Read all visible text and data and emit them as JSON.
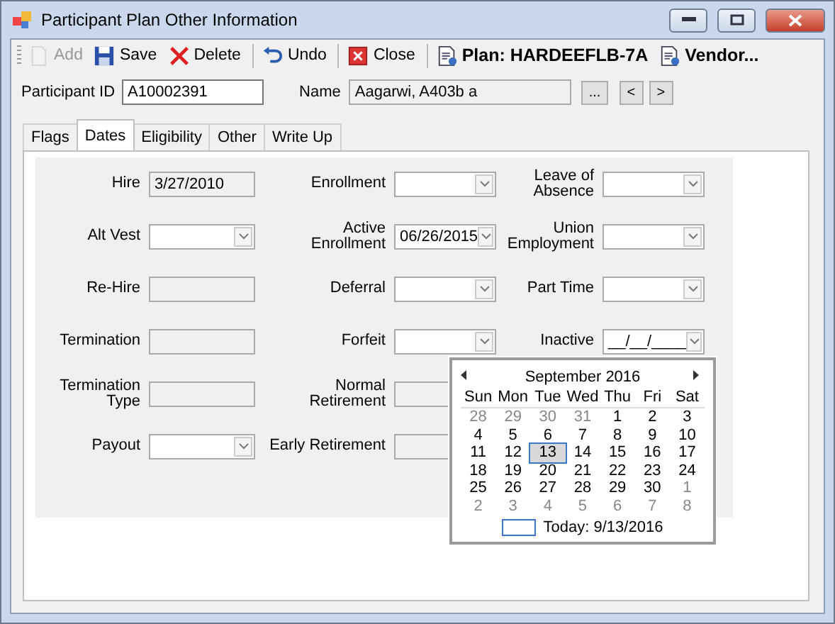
{
  "window": {
    "title": "Participant Plan Other Information"
  },
  "toolbar": [
    {
      "label": "Add",
      "disabled": true,
      "bold": false,
      "separator_before": false
    },
    {
      "label": "Save",
      "disabled": false,
      "bold": false,
      "separator_before": false
    },
    {
      "label": "Delete",
      "disabled": false,
      "bold": false,
      "separator_before": false
    },
    {
      "label": "Undo",
      "disabled": false,
      "bold": false,
      "separator_before": true
    },
    {
      "label": "Close",
      "disabled": false,
      "bold": false,
      "separator_before": true
    },
    {
      "label": "Plan: HARDEEFLB-7A",
      "disabled": false,
      "bold": true,
      "separator_before": true
    },
    {
      "label": "Vendor...",
      "disabled": false,
      "bold": true,
      "separator_before": false
    }
  ],
  "header": {
    "participant_id_label": "Participant ID",
    "participant_id": "A10002391",
    "name_label": "Name",
    "name": "Aagarwi, A403b a",
    "browse_button": "...",
    "prev_button": "<",
    "next_button": ">"
  },
  "tabs": [
    {
      "label": "Flags",
      "selected": false
    },
    {
      "label": "Dates",
      "selected": true
    },
    {
      "label": "Eligibility",
      "selected": false
    },
    {
      "label": "Other",
      "selected": false
    },
    {
      "label": "Write Up",
      "selected": false
    }
  ],
  "columns": [
    [
      {
        "label": "Hire",
        "kind": "text",
        "value": "3/27/2010"
      },
      {
        "label": "Alt Vest",
        "kind": "combo"
      },
      {
        "label": "Re-Hire",
        "kind": "text"
      },
      {
        "label": "Termination",
        "kind": "text"
      },
      {
        "label": "Termination Type",
        "kind": "text"
      },
      {
        "label": "Payout",
        "kind": "combo"
      }
    ],
    [
      {
        "label": "Enrollment",
        "kind": "combo"
      },
      {
        "label": "Active Enrollment",
        "kind": "combo",
        "value": "06/26/2015"
      },
      {
        "label": "Deferral",
        "kind": "combo"
      },
      {
        "label": "Forfeit",
        "kind": "combo"
      },
      {
        "label": "Normal Retirement",
        "kind": "text"
      },
      {
        "label": "Early Retirement",
        "kind": "text"
      }
    ],
    [
      {
        "label": "Leave of Absence",
        "kind": "combo"
      },
      {
        "label": "Union Employment",
        "kind": "combo"
      },
      {
        "label": "Part Time",
        "kind": "combo"
      },
      {
        "label": "Inactive",
        "kind": "combo",
        "value": "__/__/____"
      }
    ]
  ],
  "calendar": {
    "month": "September 2016",
    "weekdays": [
      "Sun",
      "Mon",
      "Tue",
      "Wed",
      "Thu",
      "Fri",
      "Sat"
    ],
    "weeks": [
      [
        {
          "day": "28",
          "other_month": true,
          "selected": false
        },
        {
          "day": "29",
          "other_month": true,
          "selected": false
        },
        {
          "day": "30",
          "other_month": true,
          "selected": false
        },
        {
          "day": "31",
          "other_month": true,
          "selected": false
        },
        {
          "day": "1",
          "other_month": false,
          "selected": false
        },
        {
          "day": "2",
          "other_month": false,
          "selected": false
        },
        {
          "day": "3",
          "other_month": false,
          "selected": false
        }
      ],
      [
        {
          "day": "4",
          "other_month": false,
          "selected": false
        },
        {
          "day": "5",
          "other_month": false,
          "selected": false
        },
        {
          "day": "6",
          "other_month": false,
          "selected": false
        },
        {
          "day": "7",
          "other_month": false,
          "selected": false
        },
        {
          "day": "8",
          "other_month": false,
          "selected": false
        },
        {
          "day": "9",
          "other_month": false,
          "selected": false
        },
        {
          "day": "10",
          "other_month": false,
          "selected": false
        }
      ],
      [
        {
          "day": "11",
          "other_month": false,
          "selected": false
        },
        {
          "day": "12",
          "other_month": false,
          "selected": false
        },
        {
          "day": "13",
          "other_month": false,
          "selected": true
        },
        {
          "day": "14",
          "other_month": false,
          "selected": false
        },
        {
          "day": "15",
          "other_month": false,
          "selected": false
        },
        {
          "day": "16",
          "other_month": false,
          "selected": false
        },
        {
          "day": "17",
          "other_month": false,
          "selected": false
        }
      ],
      [
        {
          "day": "18",
          "other_month": false,
          "selected": false
        },
        {
          "day": "19",
          "other_month": false,
          "selected": false
        },
        {
          "day": "20",
          "other_month": false,
          "selected": false
        },
        {
          "day": "21",
          "other_month": false,
          "selected": false
        },
        {
          "day": "22",
          "other_month": false,
          "selected": false
        },
        {
          "day": "23",
          "other_month": false,
          "selected": false
        },
        {
          "day": "24",
          "other_month": false,
          "selected": false
        }
      ],
      [
        {
          "day": "25",
          "other_month": false,
          "selected": false
        },
        {
          "day": "26",
          "other_month": false,
          "selected": false
        },
        {
          "day": "27",
          "other_month": false,
          "selected": false
        },
        {
          "day": "28",
          "other_month": false,
          "selected": false
        },
        {
          "day": "29",
          "other_month": false,
          "selected": false
        },
        {
          "day": "30",
          "other_month": false,
          "selected": false
        },
        {
          "day": "1",
          "other_month": true,
          "selected": false
        }
      ],
      [
        {
          "day": "2",
          "other_month": true,
          "selected": false
        },
        {
          "day": "3",
          "other_month": true,
          "selected": false
        },
        {
          "day": "4",
          "other_month": true,
          "selected": false
        },
        {
          "day": "5",
          "other_month": true,
          "selected": false
        },
        {
          "day": "6",
          "other_month": true,
          "selected": false
        },
        {
          "day": "7",
          "other_month": true,
          "selected": false
        },
        {
          "day": "8",
          "other_month": true,
          "selected": false
        }
      ]
    ],
    "today": "Today: 9/13/2016"
  }
}
